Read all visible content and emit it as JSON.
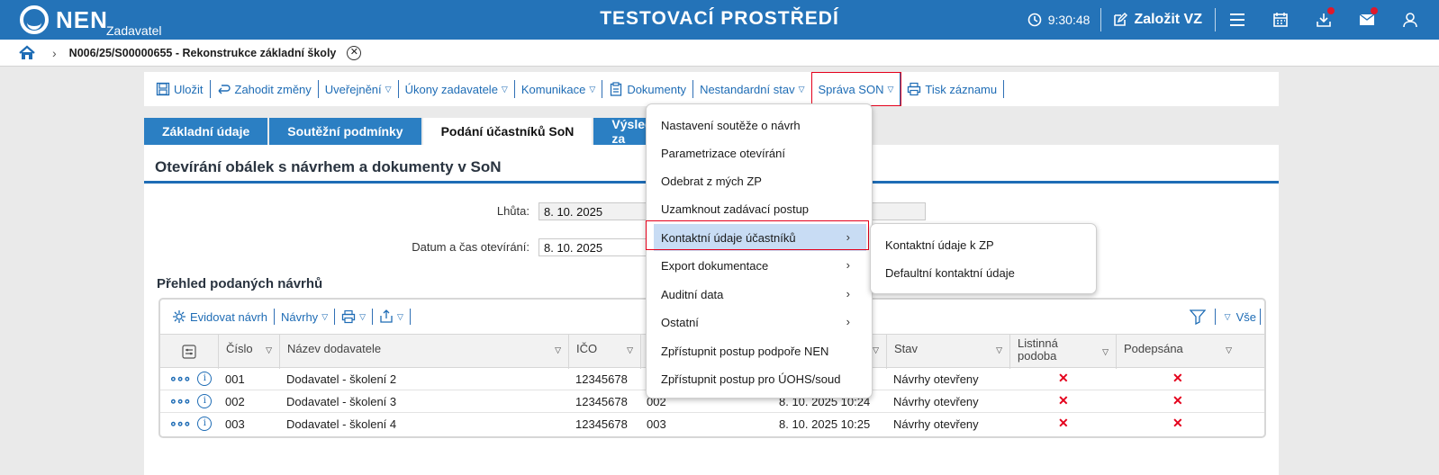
{
  "header": {
    "logo_text": "NEN",
    "logo_sub": "Zadavatel",
    "env_title": "TESTOVACÍ PROSTŘEDÍ",
    "time": "9:30:48",
    "create_label": "Založit VZ"
  },
  "breadcrumb": {
    "text": "N006/25/S00000655 - Rekonstrukce základní školy"
  },
  "toolbar": {
    "save": "Uložit",
    "discard": "Zahodit změny",
    "publish": "Uveřejnění",
    "acts": "Úkony zadavatele",
    "communication": "Komunikace",
    "documents": "Dokumenty",
    "nonstandard": "Nestandardní stav",
    "son_admin": "Správa SON",
    "print": "Tisk záznamu"
  },
  "tabs": [
    "Základní údaje",
    "Soutěžní podmínky",
    "Podání účastníků SoN",
    "Výsledek za"
  ],
  "panel": {
    "title": "Otevírání obálek s návrhem a dokumenty v SoN",
    "deadline_label": "Lhůta:",
    "deadline_value": "8. 10. 2025",
    "opening_label": "Datum a čas otevírání:",
    "opening_value": "8. 10. 2025",
    "section_title": "Přehled podaných návrhů"
  },
  "grid": {
    "toolbar": {
      "record": "Evidovat návrh",
      "proposals": "Návrhy",
      "all": "Vše"
    },
    "columns": [
      "Číslo",
      "Název dodavatele",
      "IČO",
      "Stav",
      "Listinná podoba",
      "Podepsána"
    ],
    "rows": [
      {
        "number": "001",
        "supplier": "Dodavatel - školení 2",
        "ico": "12345678",
        "extra": "",
        "date": "",
        "status": "Návrhy otevřeny"
      },
      {
        "number": "002",
        "supplier": "Dodavatel - školení 3",
        "ico": "12345678",
        "extra": "002",
        "date": "8. 10. 2025 10:24",
        "status": "Návrhy otevřeny"
      },
      {
        "number": "003",
        "supplier": "Dodavatel - školení 4",
        "ico": "12345678",
        "extra": "003",
        "date": "8. 10. 2025 10:25",
        "status": "Návrhy otevřeny"
      }
    ]
  },
  "menu": {
    "items": [
      "Nastavení soutěže o návrh",
      "Parametrizace otevírání",
      "Odebrat z mých ZP",
      "Uzamknout zadávací postup",
      "Kontaktní údaje účastníků",
      "Export dokumentace",
      "Auditní data",
      "Ostatní",
      "Zpřístupnit postup podpoře NEN",
      "Zpřístupnit postup pro ÚOHS/soud"
    ],
    "submenu": [
      "Kontaktní údaje k ZP",
      "Defaultní kontaktní údaje"
    ]
  },
  "colors": {
    "brand": "#2473b8",
    "highlight": "#e4001b",
    "menu_hover": "#c8dcf4"
  }
}
